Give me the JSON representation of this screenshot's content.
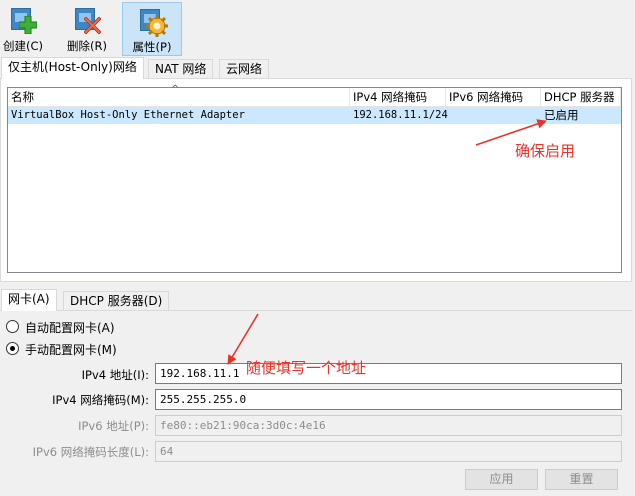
{
  "toolbar": {
    "create": "创建(C)",
    "delete": "删除(R)",
    "properties": "属性(P)"
  },
  "top_tabs": [
    "仅主机(Host-Only)网络",
    "NAT 网络",
    "云网络"
  ],
  "list": {
    "headers": [
      "名称",
      "IPv4 网络掩码",
      "IPv6 网络掩码",
      "DHCP 服务器"
    ],
    "rows": [
      {
        "name": "VirtualBox Host-Only Ethernet Adapter",
        "ipv4": "192.168.11.1/24",
        "ipv6": "",
        "dhcp": "已启用"
      }
    ]
  },
  "bottom_tabs": [
    "网卡(A)",
    "DHCP 服务器(D)"
  ],
  "adapter": {
    "auto_label": "自动配置网卡(A)",
    "manual_label": "手动配置网卡(M)",
    "mode": "manual",
    "ipv4_address_label": "IPv4 地址(I):",
    "ipv4_address": "192.168.11.1",
    "ipv4_mask_label": "IPv4 网络掩码(M):",
    "ipv4_mask": "255.255.255.0",
    "ipv6_address_label": "IPv6 地址(P):",
    "ipv6_address": "fe80::eb21:90ca:3d0c:4e16",
    "ipv6_prefix_label": "IPv6 网络掩码长度(L):",
    "ipv6_prefix": "64"
  },
  "buttons": {
    "apply": "应用",
    "reset": "重置"
  },
  "annotations": {
    "ensure_enabled": "确保启用",
    "fill_any_address": "随便填写一个地址",
    "color": "#e8322a"
  }
}
